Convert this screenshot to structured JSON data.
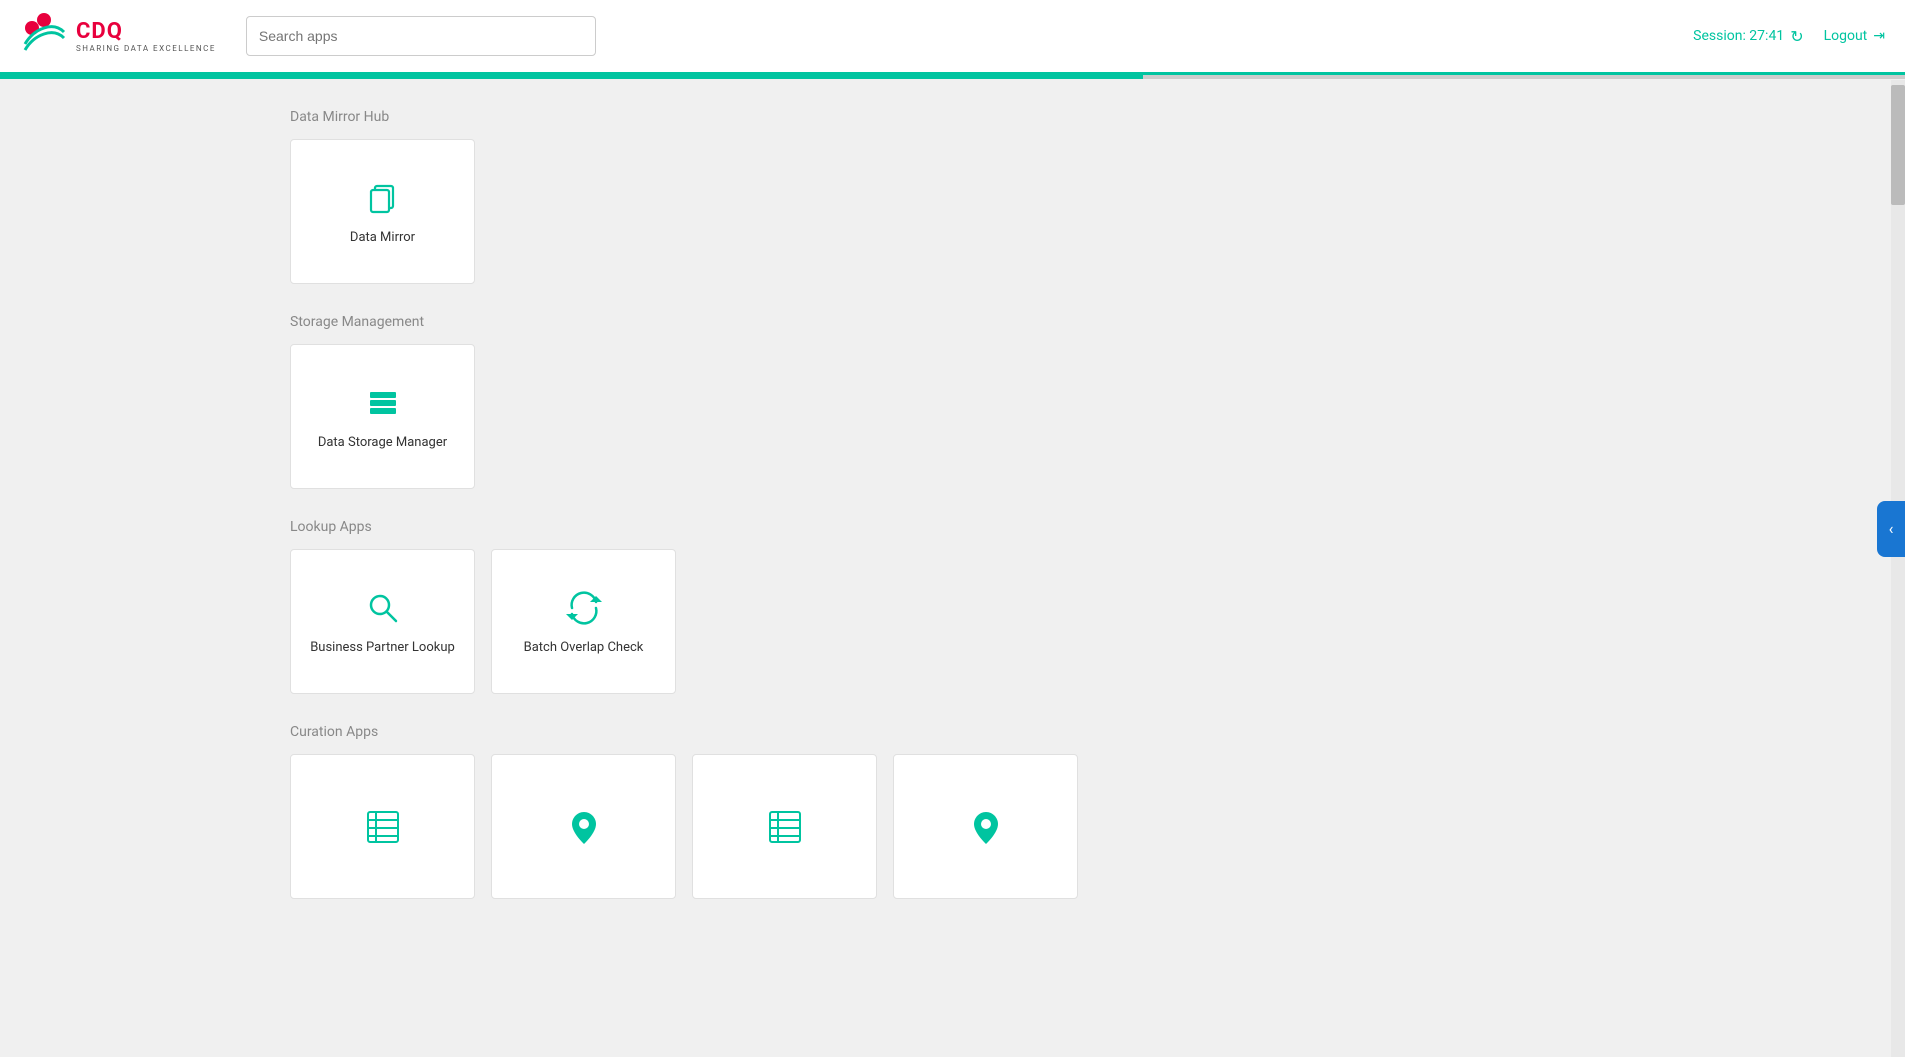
{
  "header": {
    "logo_cdq": "CDQ",
    "logo_subtitle": "SHARING DATA EXCELLENCE",
    "search_placeholder": "Search apps",
    "session_label": "Session: 27:41",
    "logout_label": "Logout"
  },
  "sections": [
    {
      "id": "data-mirror-hub",
      "title": "Data Mirror Hub",
      "apps": [
        {
          "id": "data-mirror",
          "label": "Data Mirror",
          "icon": "copy"
        }
      ]
    },
    {
      "id": "storage-management",
      "title": "Storage Management",
      "apps": [
        {
          "id": "data-storage-manager",
          "label": "Data Storage Manager",
          "icon": "database"
        }
      ]
    },
    {
      "id": "lookup-apps",
      "title": "Lookup Apps",
      "apps": [
        {
          "id": "business-partner-lookup",
          "label": "Business Partner Lookup",
          "icon": "search"
        },
        {
          "id": "batch-overlap-check",
          "label": "Batch Overlap Check",
          "icon": "sync"
        }
      ]
    },
    {
      "id": "curation-apps",
      "title": "Curation Apps",
      "apps": [
        {
          "id": "curation-app-1",
          "label": "",
          "icon": "building-list"
        },
        {
          "id": "curation-app-2",
          "label": "",
          "icon": "location"
        },
        {
          "id": "curation-app-3",
          "label": "",
          "icon": "building-list"
        },
        {
          "id": "curation-app-4",
          "label": "",
          "icon": "location"
        }
      ]
    }
  ],
  "sidebar_toggle": "‹"
}
